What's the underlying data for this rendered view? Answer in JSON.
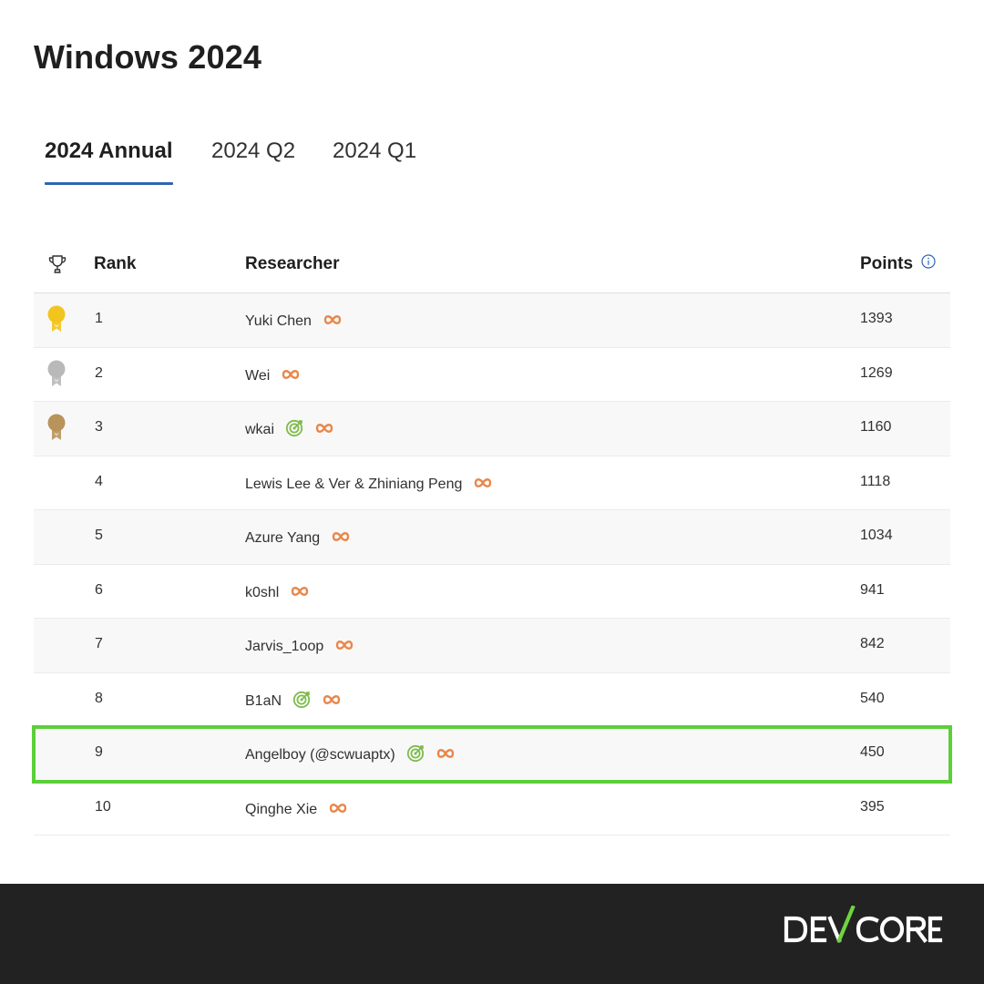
{
  "page": {
    "title": "Windows 2024"
  },
  "tabs": [
    {
      "label": "2024 Annual",
      "active": true
    },
    {
      "label": "2024 Q2",
      "active": false
    },
    {
      "label": "2024 Q1",
      "active": false
    }
  ],
  "table": {
    "headers": {
      "trophy_icon": "trophy-icon",
      "rank": "Rank",
      "researcher": "Researcher",
      "points": "Points",
      "points_info_icon": "info-icon"
    },
    "rows": [
      {
        "rank": "1",
        "researcher": "Yuki Chen",
        "points": "1393",
        "medal": "gold",
        "badges": [
          "infinity"
        ]
      },
      {
        "rank": "2",
        "researcher": "Wei",
        "points": "1269",
        "medal": "silver",
        "badges": [
          "infinity"
        ]
      },
      {
        "rank": "3",
        "researcher": "wkai",
        "points": "1160",
        "medal": "bronze",
        "badges": [
          "target",
          "infinity"
        ]
      },
      {
        "rank": "4",
        "researcher": "Lewis Lee & Ver & Zhiniang Peng",
        "points": "1118",
        "medal": "",
        "badges": [
          "infinity"
        ]
      },
      {
        "rank": "5",
        "researcher": "Azure Yang",
        "points": "1034",
        "medal": "",
        "badges": [
          "infinity"
        ]
      },
      {
        "rank": "6",
        "researcher": "k0shl",
        "points": "941",
        "medal": "",
        "badges": [
          "infinity"
        ]
      },
      {
        "rank": "7",
        "researcher": "Jarvis_1oop",
        "points": "842",
        "medal": "",
        "badges": [
          "infinity"
        ]
      },
      {
        "rank": "8",
        "researcher": "B1aN",
        "points": "540",
        "medal": "",
        "badges": [
          "target",
          "infinity"
        ]
      },
      {
        "rank": "9",
        "researcher": "Angelboy (@scwuaptx)",
        "points": "450",
        "medal": "",
        "badges": [
          "target",
          "infinity"
        ],
        "highlighted": true
      },
      {
        "rank": "10",
        "researcher": "Qinghe Xie",
        "points": "395",
        "medal": "",
        "badges": [
          "infinity"
        ]
      }
    ]
  },
  "footer": {
    "logo_text": "DEVCORE"
  },
  "colors": {
    "tab_underline": "#2f64b5",
    "highlight": "#5bcf3a",
    "infinity_badge": "#e8874a",
    "target_badge": "#7dbb4a",
    "gold": "#f2c41e",
    "silver": "#b9b9b9",
    "bronze": "#b8935a",
    "footer_bg": "#222222",
    "logo_green": "#6fd441"
  }
}
